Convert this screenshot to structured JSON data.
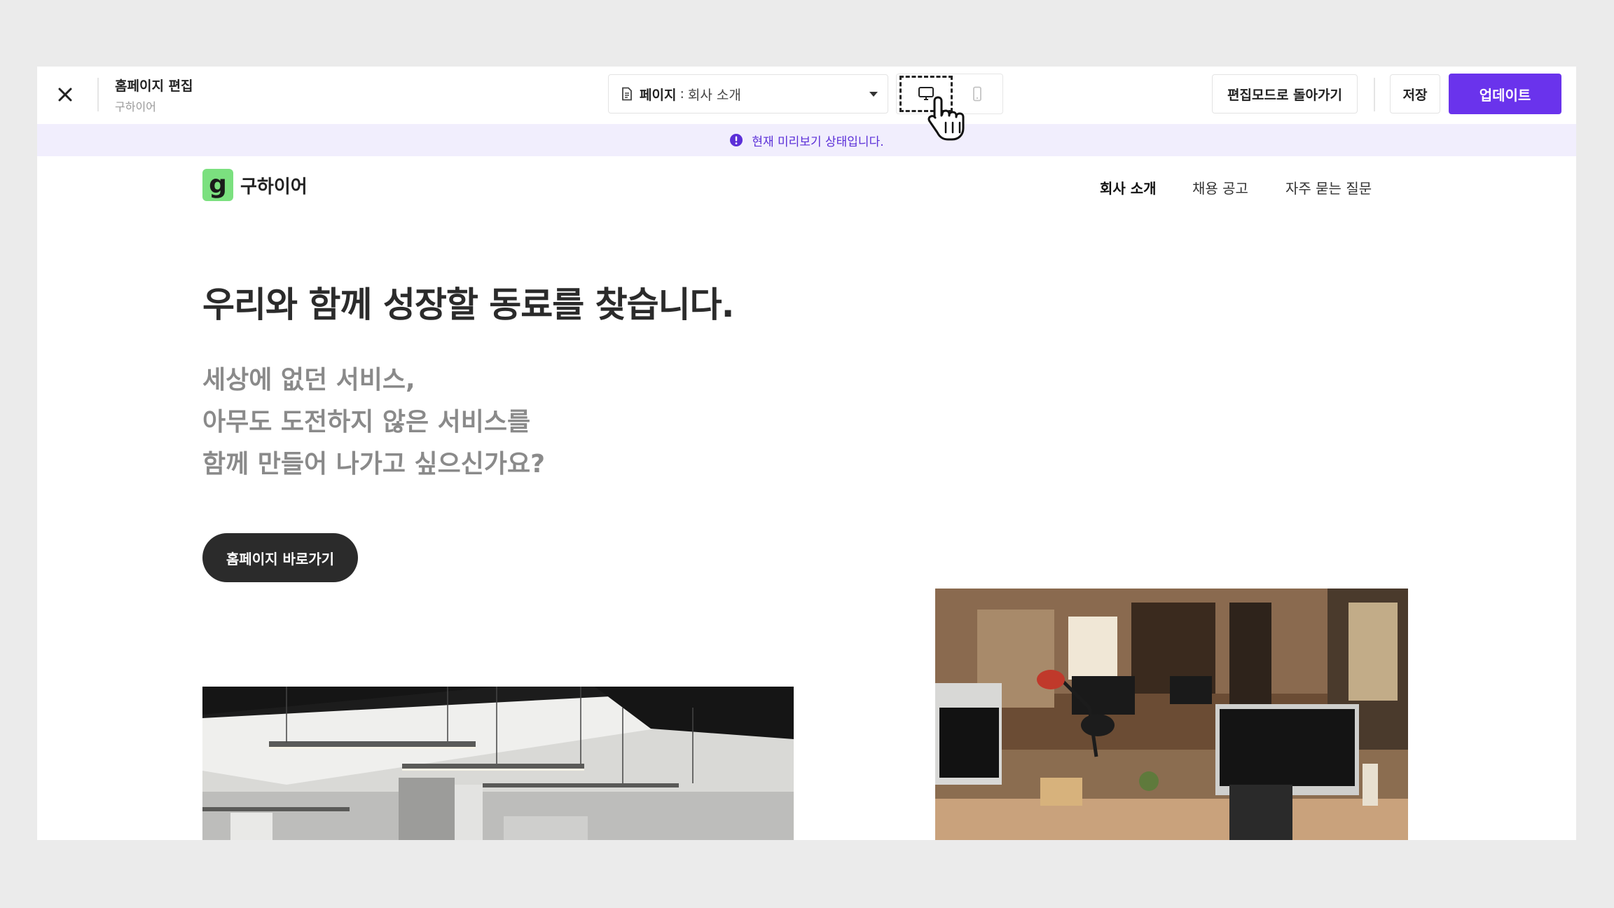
{
  "toolbar": {
    "title": "홈페이지 편집",
    "subtitle": "구하이어",
    "page_select": {
      "label": "페이지",
      "separator": ":",
      "value": "회사 소개"
    },
    "return_button": "편집모드로 돌아가기",
    "save_button": "저장",
    "update_button": "업데이트"
  },
  "banner": {
    "text": "현재 미리보기 상태입니다."
  },
  "site": {
    "logo_letter": "g",
    "logo_text": "구하이어",
    "nav": [
      "회사 소개",
      "채용 공고",
      "자주 묻는 질문"
    ],
    "hero_title": "우리와 함께 성장할 동료를 찾습니다.",
    "hero_lines": [
      "세상에 없던 서비스,",
      "아무도 도전하지 않은 서비스를",
      "함께 만들어 나가고 싶으신가요?"
    ],
    "hero_button": "홈페이지 바로가기"
  },
  "colors": {
    "accent": "#6a33ec",
    "banner_bg": "#f1eefd",
    "logo_green": "#7be07f"
  }
}
